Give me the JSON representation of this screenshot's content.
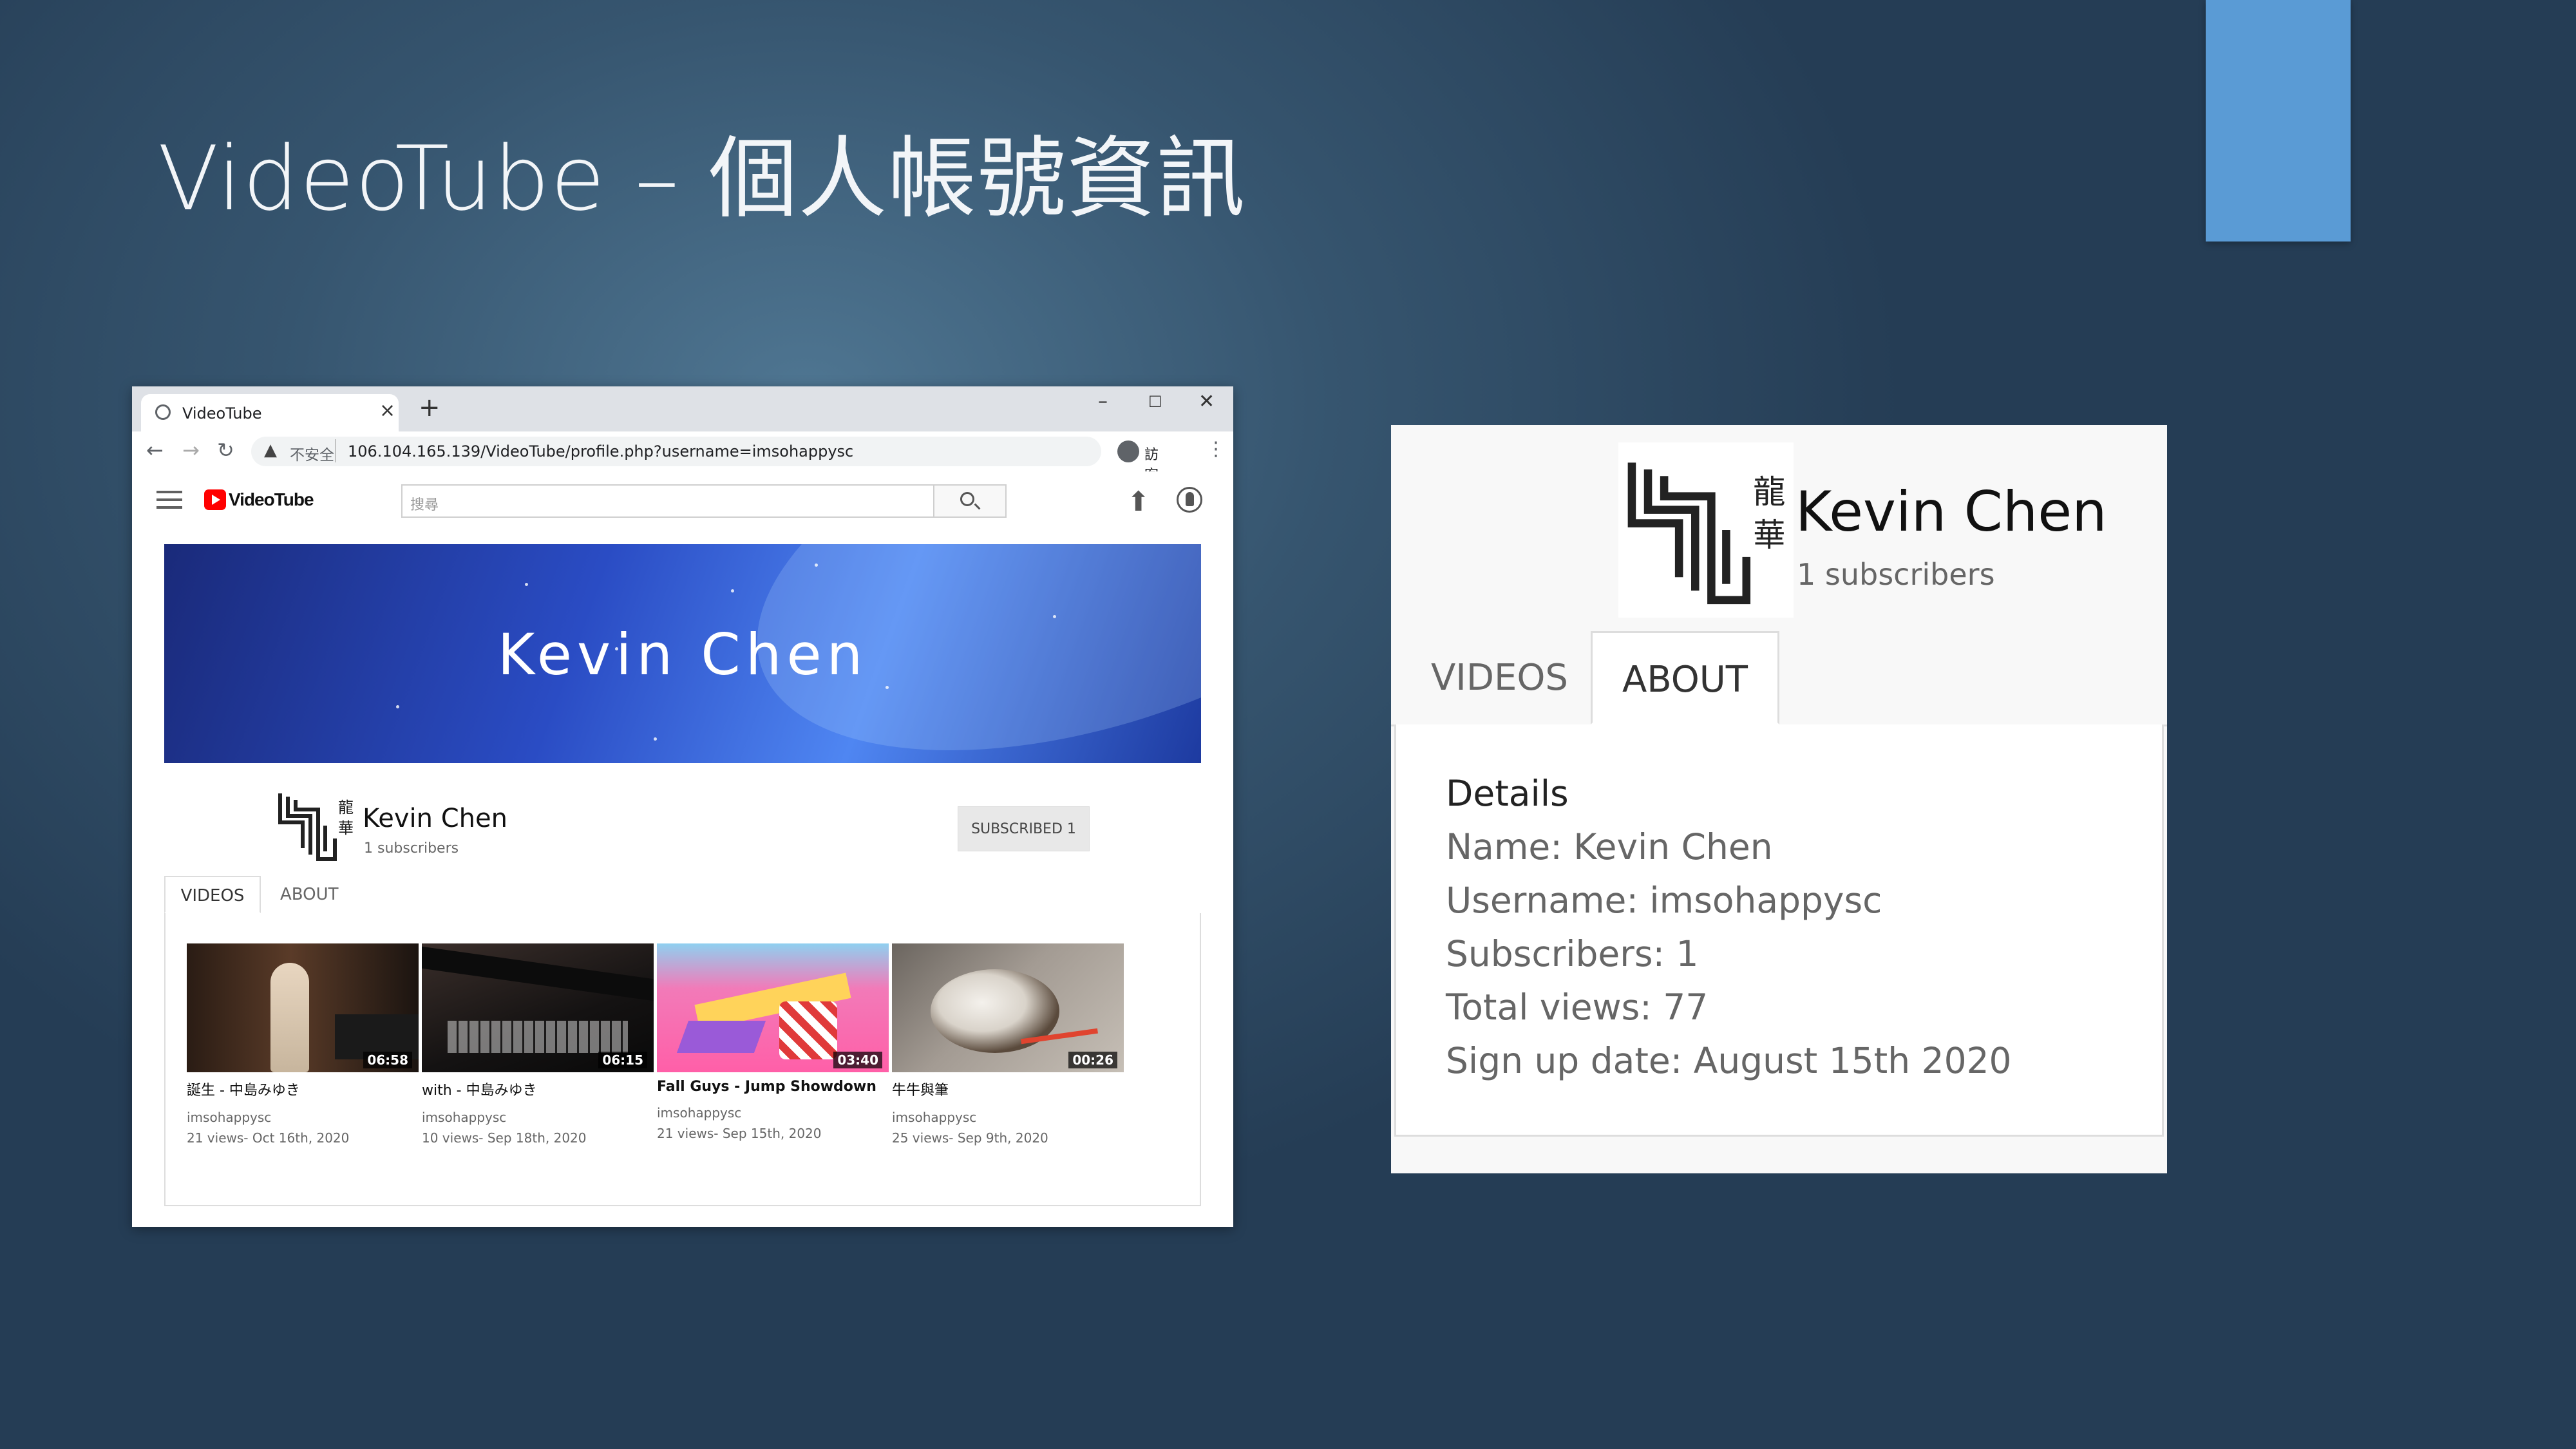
{
  "slide": {
    "title": "VideoTube – 個人帳號資訊"
  },
  "browser": {
    "tab_title": "VideoTube",
    "new_tab": "+",
    "window_controls": {
      "minimize": "–",
      "maximize": "☐",
      "close": "✕"
    },
    "security_label": "不安全",
    "url": "106.104.165.139/VideoTube/profile.php?username=imsohappysc",
    "guest_label": "訪客"
  },
  "site": {
    "logo": "VideoTube",
    "search_placeholder": "搜尋"
  },
  "channel": {
    "banner_name": "Kevin Chen",
    "name": "Kevin Chen",
    "subscribers": "1 subscribers",
    "subscribe_button": "SUBSCRIBED 1",
    "tabs": [
      "VIDEOS",
      "ABOUT"
    ],
    "videos": [
      {
        "title": "誕生 - 中島みゆき",
        "channel": "imsohappysc",
        "meta": "21 views- Oct 16th, 2020",
        "duration": "06:58"
      },
      {
        "title": "with - 中島みゆき",
        "channel": "imsohappysc",
        "meta": "10 views- Sep 18th, 2020",
        "duration": "06:15"
      },
      {
        "title": "Fall Guys - Jump Showdown",
        "channel": "imsohappysc",
        "meta": "21 views- Sep 15th, 2020",
        "duration": "03:40"
      },
      {
        "title": "牛牛與筆",
        "channel": "imsohappysc",
        "meta": "25 views- Sep 9th, 2020",
        "duration": "00:26"
      }
    ]
  },
  "about_panel": {
    "name": "Kevin Chen",
    "subscribers": "1 subscribers",
    "tabs": [
      "VIDEOS",
      "ABOUT"
    ],
    "details_heading": "Details",
    "details": [
      "Name: Kevin Chen",
      "Username: imsohappysc",
      "Subscribers: 1",
      "Total views: 77",
      "Sign up date: August 15th 2020"
    ]
  },
  "colors": {
    "accent_bar": "#5a9bd5",
    "youtube_red": "#ff0000",
    "banner_blue": "#2a4cc4"
  }
}
